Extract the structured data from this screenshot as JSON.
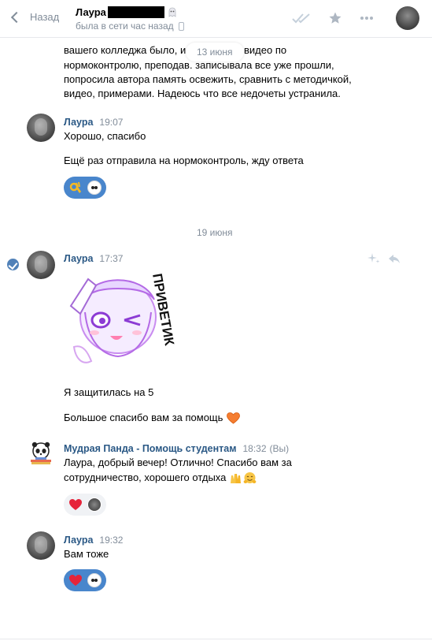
{
  "header": {
    "back_label": "Назад",
    "contact_name": "Лаура",
    "status": "была в сети час назад"
  },
  "top_partial": {
    "lines": [
      "вашего колледжа было, и",
      "видео по",
      "нормоконтролю, преподав. записывала все уже прошли,",
      "попросила автора память освежить, сравнить с методичкой,",
      "видео, примерами. Надеюсь что все недочеты устранила."
    ],
    "date_pill": "13 июня"
  },
  "messages": [
    {
      "author": "Лаура",
      "time": "19:07",
      "lines": [
        "Хорошо, спасибо",
        "Ещё раз отправила на нормоконтроль, жду ответа"
      ],
      "reactions": [
        "ok-hand-emoji",
        "panda-avatar"
      ]
    },
    {
      "date_separator": "19 июня"
    },
    {
      "author": "Лаура",
      "time": "17:37",
      "sticker_text": "ПРИВЕТИК",
      "lines": [
        "Я защитилась на 5",
        "Большое спасибо вам за помощь"
      ],
      "emoji": "orange-heart"
    },
    {
      "author": "Мудрая Панда - Помощь студентам",
      "time": "18:32",
      "tag": "(Вы)",
      "lines": [
        "Лаура, добрый вечер! Отлично! Спасибо вам за",
        "сотрудничество, хорошего отдыха"
      ],
      "reactions": [
        "red-heart",
        "laura-avatar"
      ]
    },
    {
      "author": "Лаура",
      "time": "19:32",
      "lines": [
        "Вам тоже"
      ],
      "reactions": [
        "red-heart",
        "panda-avatar"
      ]
    }
  ],
  "colors": {
    "link": "#2a5885",
    "muted": "#818c99",
    "reaction_blue": "#4986cc",
    "reaction_grey": "#f0f2f5"
  }
}
